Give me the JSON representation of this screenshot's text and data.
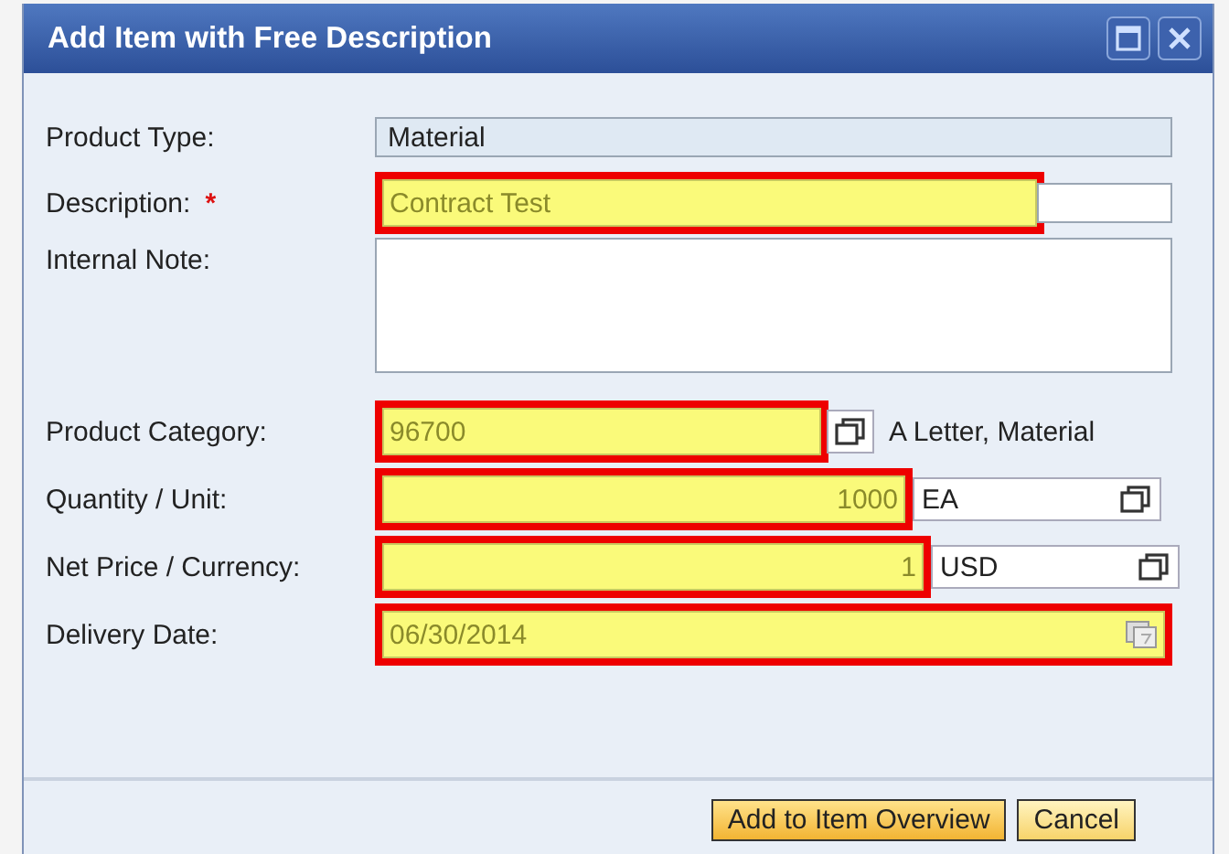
{
  "window": {
    "title": "Add Item with Free Description"
  },
  "fields": [
    {
      "kind": "readonly",
      "label": "Product Type:",
      "value": "Material",
      "highlighted": false
    },
    {
      "kind": "text",
      "label": "Description:",
      "required_mark": "*",
      "value": "Contract Test",
      "highlighted": true
    },
    {
      "kind": "textarea",
      "label": "Internal Note:",
      "highlighted": false
    },
    {
      "kind": "value-help",
      "label": "Product Category:",
      "value": "96700",
      "suffix": "A Letter, Material",
      "highlighted": true
    },
    {
      "kind": "amount",
      "label": "Quantity / Unit:",
      "value": "1000",
      "unit": "EA",
      "highlighted": true
    },
    {
      "kind": "amount",
      "label": "Net Price / Currency:",
      "value": "1",
      "unit": "USD",
      "highlighted": true
    },
    {
      "kind": "date",
      "label": "Delivery Date:",
      "value": "06/30/2014",
      "highlighted": true
    }
  ],
  "buttons": [
    {
      "label": "Add to Item Overview",
      "kind": "primary"
    },
    {
      "label": "Cancel",
      "kind": "secondary"
    }
  ]
}
